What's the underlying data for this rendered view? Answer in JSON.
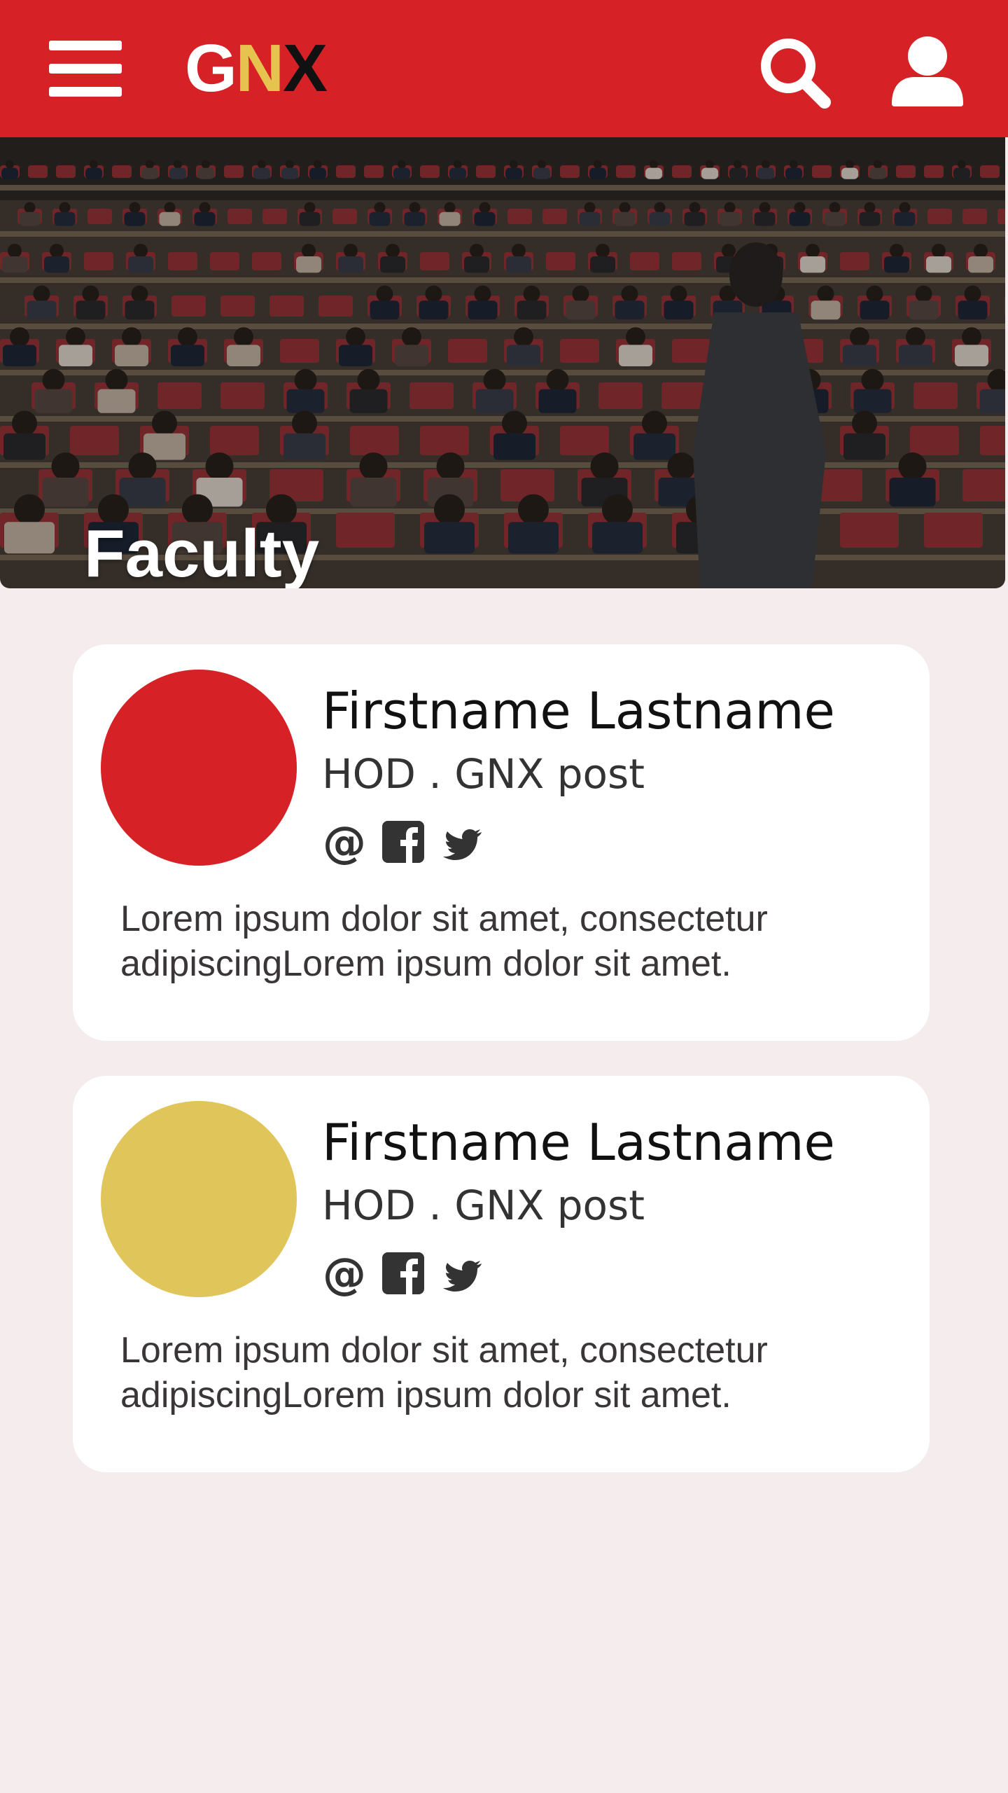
{
  "header": {
    "logo": [
      "G",
      "N",
      "X"
    ],
    "logo_colors": [
      "#ffffff",
      "#e6c34f",
      "#111111"
    ],
    "bg_color": "#d62226",
    "icons": [
      "menu-icon",
      "search-icon",
      "user-icon"
    ]
  },
  "hero": {
    "title": "Faculty"
  },
  "faculty": [
    {
      "name": "Firstname Lastname",
      "role": "HOD . GNX post",
      "bio": "Lorem ipsum dolor sit amet, consectetur adipiscingLorem ipsum dolor sit amet.",
      "avatar_color": "#d62226",
      "social_icons": [
        "at-icon",
        "facebook-icon",
        "twitter-icon"
      ]
    },
    {
      "name": "Firstname Lastname",
      "role": "HOD . GNX post",
      "bio": "Lorem ipsum dolor sit amet, consectetur adipiscingLorem ipsum dolor sit amet.",
      "avatar_color": "#e0c55a",
      "social_icons": [
        "at-icon",
        "facebook-icon",
        "twitter-icon"
      ]
    }
  ]
}
